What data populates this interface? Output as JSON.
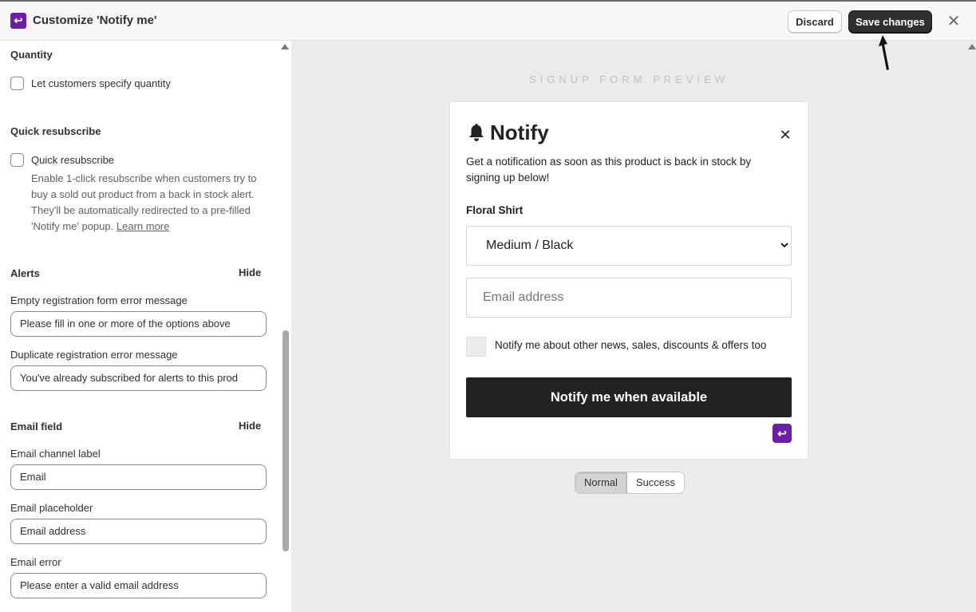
{
  "header": {
    "logo_glyph": "↩",
    "title": "Customize 'Notify me'",
    "discard_label": "Discard",
    "save_label": "Save changes",
    "close_glyph": "✕"
  },
  "sidebar": {
    "quantity": {
      "title": "Quantity",
      "checkbox_label": "Let customers specify quantity",
      "checked": false
    },
    "quick_resubscribe": {
      "title": "Quick resubscribe",
      "checkbox_label": "Quick resubscribe",
      "checked": false,
      "help_text": "Enable 1-click resubscribe when customers try to buy a sold out product from a back in stock alert. They'll be automatically redirected to a pre-filled 'Notify me' popup.",
      "learn_more": "Learn more"
    },
    "alerts": {
      "title": "Alerts",
      "hide_label": "Hide",
      "empty_error_label": "Empty registration form error message",
      "empty_error_value": "Please fill in one or more of the options above",
      "duplicate_error_label": "Duplicate registration error message",
      "duplicate_error_value": "You've already subscribed for alerts to this prod"
    },
    "email_field": {
      "title": "Email field",
      "hide_label": "Hide",
      "channel_label_label": "Email channel label",
      "channel_label_value": "Email",
      "placeholder_label": "Email placeholder",
      "placeholder_value": "Email address",
      "error_label": "Email error",
      "error_value": "Please enter a valid email address"
    }
  },
  "preview": {
    "heading": "SIGNUP FORM PREVIEW",
    "title": "Notify",
    "close_glyph": "✕",
    "description": "Get a notification as soon as this product is back in stock by signing up below!",
    "product_name": "Floral Shirt",
    "variant": "Medium / Black",
    "email_placeholder": "Email address",
    "marketing_optin_label": "Notify me about other news, sales, discounts & offers too",
    "submit_label": "Notify me when available",
    "badge_glyph": "↩",
    "modes": [
      "Normal",
      "Success"
    ],
    "active_mode": "Normal"
  },
  "colors": {
    "brand": "#6b1fa6",
    "primary_button": "#303030",
    "notify_button": "#222222"
  }
}
